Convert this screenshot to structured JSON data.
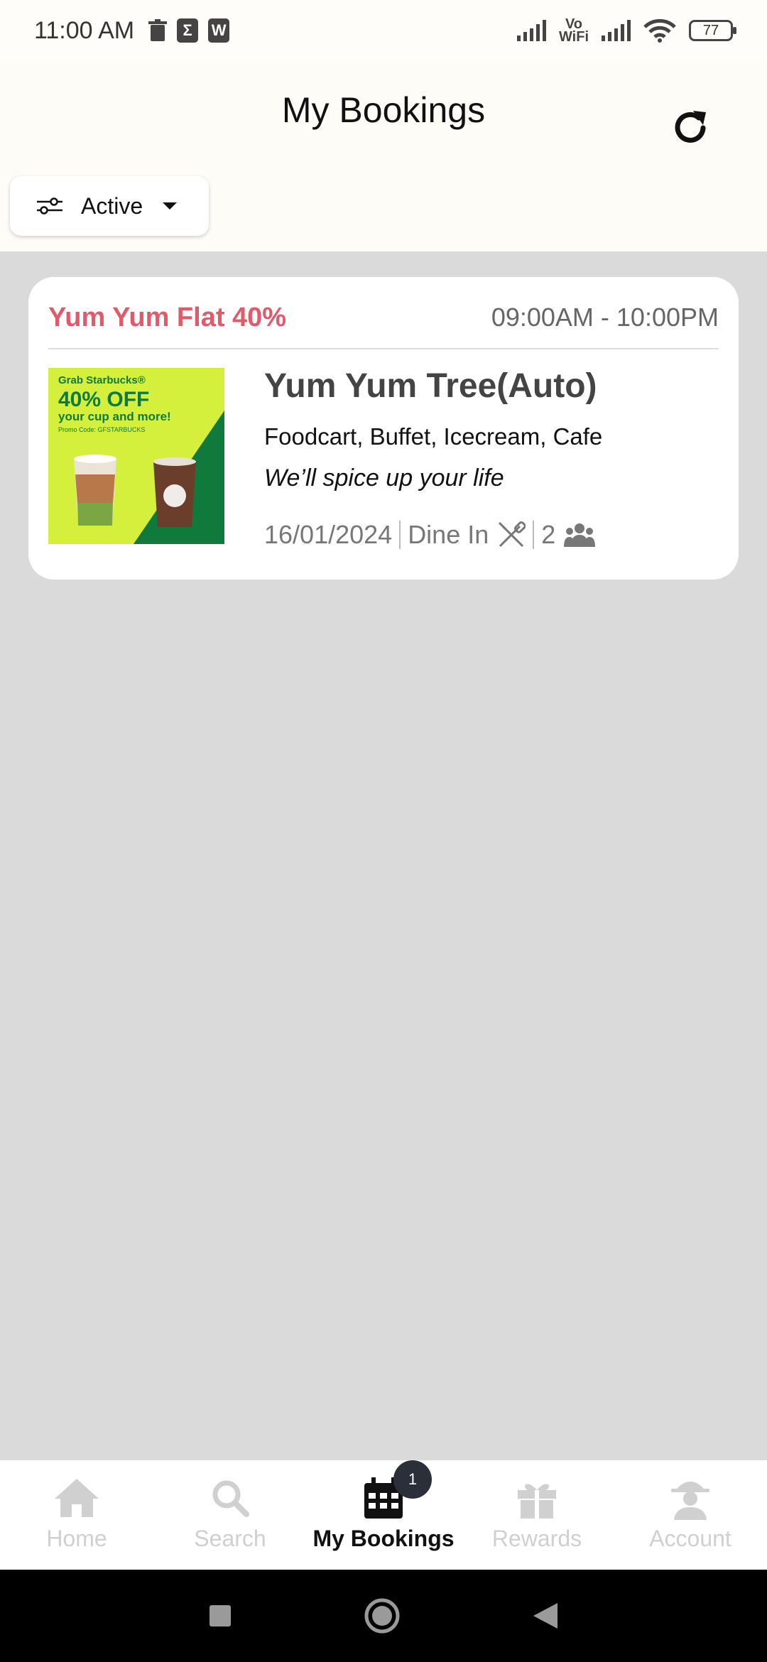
{
  "status_bar": {
    "time": "11:00 AM",
    "vowifi_top": "Vo",
    "vowifi_bottom": "WiFi",
    "battery": "77"
  },
  "header": {
    "title": "My Bookings",
    "filter_label": "Active"
  },
  "booking": {
    "offer_title": "Yum Yum Flat 40%",
    "time_range": "09:00AM - 10:00PM",
    "restaurant_name": "Yum Yum Tree(Auto)",
    "cuisines": "Foodcart, Buffet, Icecream, Cafe",
    "tagline": "We’ll spice up your life",
    "date": "16/01/2024",
    "type": "Dine In",
    "guests": "2",
    "promo_image": {
      "brand": "Grab Starbucks®",
      "headline": "40% OFF",
      "subline": "your cup and more!",
      "promo_code": "Promo Code: GFSTARBUCKS"
    }
  },
  "bottom_nav": {
    "items": [
      {
        "label": "Home",
        "icon": "home-icon"
      },
      {
        "label": "Search",
        "icon": "search-icon"
      },
      {
        "label": "My Bookings",
        "icon": "calendar-icon",
        "badge": "1"
      },
      {
        "label": "Rewards",
        "icon": "gift-icon"
      },
      {
        "label": "Account",
        "icon": "account-icon"
      }
    ]
  },
  "colors": {
    "accent_offer": "#e05a6b",
    "active_nav": "#111111",
    "inactive_nav": "#d0d0d0",
    "page_bg": "#dadada"
  }
}
